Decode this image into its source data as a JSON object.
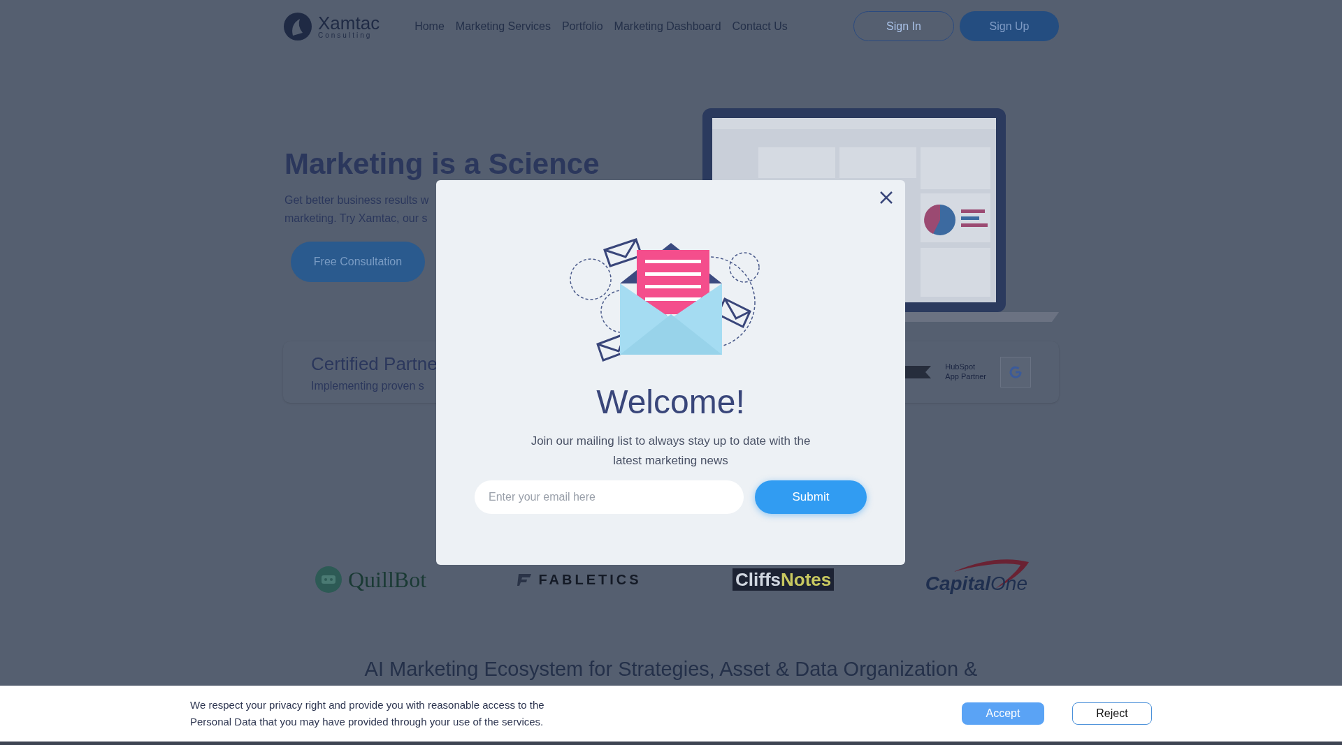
{
  "header": {
    "logo": {
      "name": "Xamtac",
      "tagline": "Consulting"
    },
    "nav": [
      "Home",
      "Marketing Services",
      "Portfolio",
      "Marketing Dashboard",
      "Contact Us"
    ],
    "buttons": [
      {
        "label": "Sign In",
        "kind": "outline"
      },
      {
        "label": "Sign Up",
        "kind": "filled"
      }
    ]
  },
  "hero": {
    "title": "Marketing is a Science",
    "text_lines": [
      "Get better business results w",
      "marketing. Try Xamtac, our s"
    ],
    "button": "Free Consultation"
  },
  "certified": {
    "title": "Certified Partne",
    "subtitle": "Implementing proven s",
    "badges": [
      {
        "kind": "ribbon"
      },
      {
        "kind": "hubspot",
        "lines": [
          "HubSpot",
          "App Partner"
        ]
      },
      {
        "kind": "google"
      }
    ]
  },
  "clients": [
    {
      "kind": "quillbot",
      "parts": [
        "QuillBot"
      ]
    },
    {
      "kind": "fabletics",
      "parts": [
        "FABLETICS"
      ]
    },
    {
      "kind": "cliffsnotes",
      "parts": [
        "Cliffs",
        "Notes"
      ]
    },
    {
      "kind": "capitalone",
      "parts": [
        "Capital",
        "One"
      ]
    }
  ],
  "section_heading": "AI Marketing Ecosystem for Strategies, Asset & Data Organization &",
  "modal": {
    "title": "Welcome!",
    "text": "Join our mailing list to always stay up to date with the latest marketing news",
    "email": {
      "placeholder": "Enter your email here"
    },
    "submit": "Submit"
  },
  "cookie": {
    "text": "We respect your privacy right and provide you with reasonable access to the Personal Data that you may have provided through your use of the services.",
    "buttons": [
      {
        "label": "Accept",
        "kind": "primary"
      },
      {
        "label": "Reject",
        "kind": "outline"
      }
    ]
  }
}
